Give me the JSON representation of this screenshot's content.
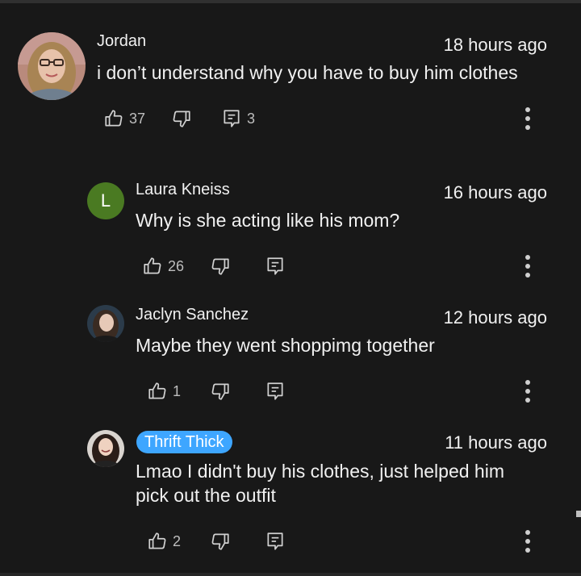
{
  "comments": [
    {
      "author": "Jordan",
      "time": "18 hours ago",
      "text": "i don’t understand why you have to buy him clothes",
      "likes": "37",
      "replies": "3"
    },
    {
      "author": "Laura Kneiss",
      "avatar_letter": "L",
      "time": "16 hours ago",
      "text": "Why is she acting like his mom?",
      "likes": "26"
    },
    {
      "author": "Jaclyn Sanchez",
      "time": "12 hours ago",
      "text": "Maybe they went shoppimg together",
      "likes": "1"
    },
    {
      "author": "Thrift Thick",
      "time": "11 hours ago",
      "text_line1": "Lmao I didn't buy his clothes, just helped him",
      "text_line2": "pick out the outfit",
      "likes": "2"
    }
  ],
  "icons": {
    "like": "thumbs-up-icon",
    "dislike": "thumbs-down-icon",
    "reply": "reply-icon",
    "more": "more-vert-icon"
  },
  "colors": {
    "background": "#181818",
    "creator_badge": "#3ea6ff",
    "letter_avatar": "#4a7a22"
  }
}
